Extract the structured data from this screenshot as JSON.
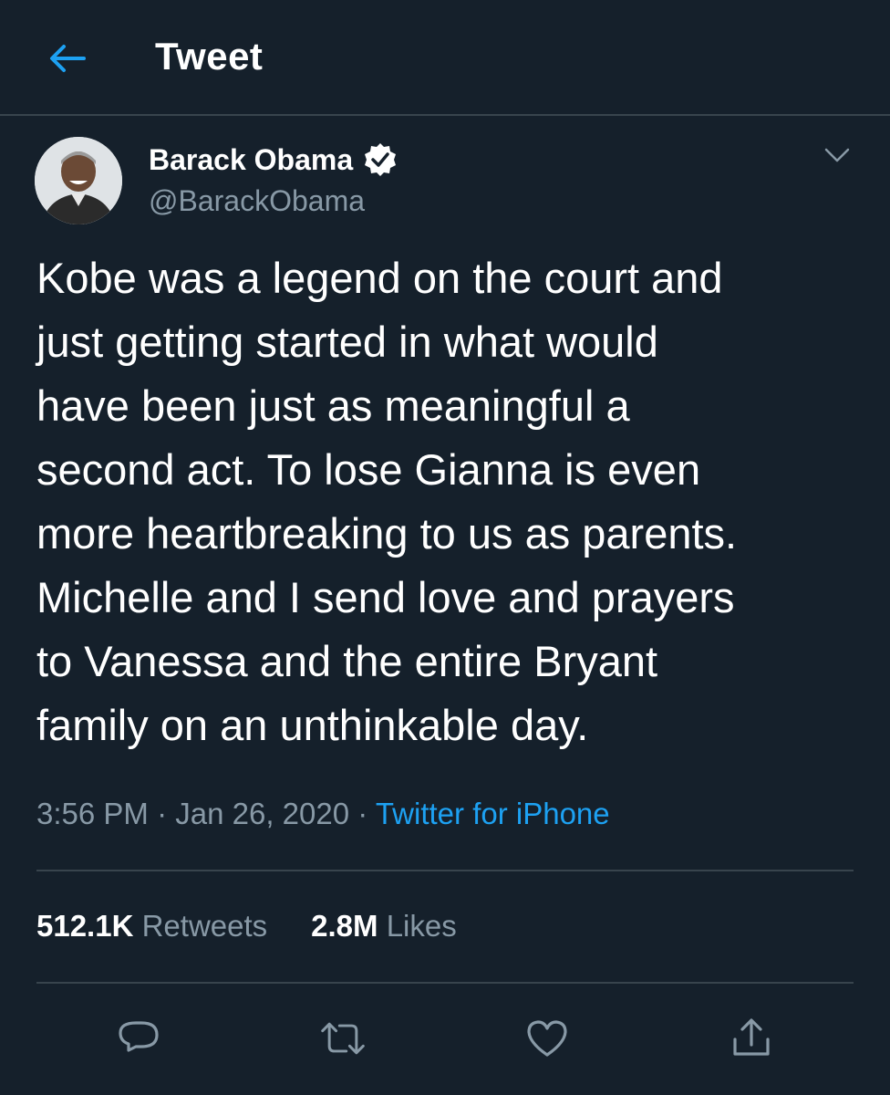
{
  "header": {
    "title": "Tweet",
    "back_icon": "arrow-left-icon"
  },
  "tweet": {
    "author": {
      "name": "Barack Obama",
      "handle": "@BarackObama",
      "verified": true
    },
    "text": "Kobe was a legend on the court and\njust getting started in what would\nhave been just as meaningful a\nsecond act. To lose Gianna is even\nmore heartbreaking to us as parents.\nMichelle and I send love and prayers\nto Vanessa and the entire Bryant\nfamily on an unthinkable day.",
    "time": "3:56 PM",
    "date": "Jan 26, 2020",
    "separator": "·",
    "source": "Twitter for iPhone"
  },
  "stats": {
    "retweets_count": "512.1K",
    "retweets_label": "Retweets",
    "likes_count": "2.8M",
    "likes_label": "Likes"
  },
  "actions": [
    "reply-icon",
    "retweet-icon",
    "like-icon",
    "share-icon"
  ],
  "colors": {
    "background": "#15202b",
    "accent": "#1da1f2",
    "secondary_text": "#8899a6",
    "divider": "#38444d"
  }
}
